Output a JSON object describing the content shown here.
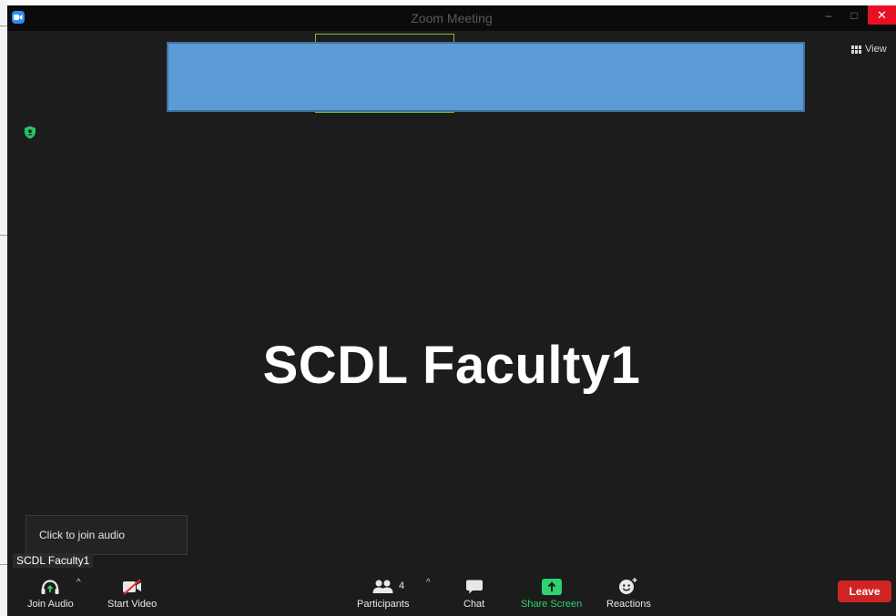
{
  "window": {
    "title": "Zoom Meeting",
    "minimize_glyph": "–",
    "maximize_glyph": "□",
    "close_glyph": "✕"
  },
  "view_button": {
    "label": "View",
    "icon": "grid-icon"
  },
  "participant": {
    "display_name": "SCDL Faculty1",
    "name_tag": "SCDL Faculty1"
  },
  "audio_popup": {
    "text": "Click to join audio"
  },
  "toolbar": {
    "join_audio": {
      "label": "Join Audio",
      "icon": "headphones-icon"
    },
    "start_video": {
      "label": "Start Video",
      "icon": "video-off-icon"
    },
    "participants": {
      "label": "Participants",
      "icon": "people-icon",
      "count": "4"
    },
    "chat": {
      "label": "Chat",
      "icon": "chat-icon"
    },
    "share_screen": {
      "label": "Share Screen",
      "icon": "share-screen-icon"
    },
    "reactions": {
      "label": "Reactions",
      "icon": "emoji-icon"
    },
    "caret": "^",
    "leave": {
      "label": "Leave"
    }
  },
  "colors": {
    "window_bg": "#1c1c1c",
    "accent_blue": "#2d8cff",
    "share_green": "#2dd36f",
    "leave_red": "#d02424",
    "redaction_blue": "#5b9bd5",
    "speaker_outline": "#78c03c"
  }
}
